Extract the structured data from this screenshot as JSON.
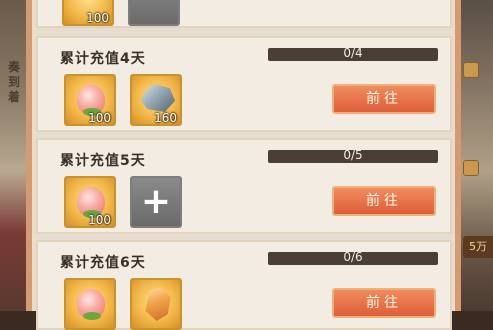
{
  "side_text": [
    "奏",
    "到",
    "着"
  ],
  "right_badge": "5万",
  "top_row": {
    "qty": "100"
  },
  "rows": [
    {
      "title": "累计充值4天",
      "progress_text": "0/4",
      "progress": 0,
      "items": [
        {
          "icon": "peach-icon",
          "qty": "100"
        },
        {
          "icon": "stone-icon",
          "qty": "160"
        }
      ],
      "button": "前往"
    },
    {
      "title": "累计充值5天",
      "progress_text": "0/5",
      "progress": 0,
      "items": [
        {
          "icon": "peach-icon",
          "qty": "100"
        },
        {
          "icon": "plus-icon",
          "qty": ""
        }
      ],
      "button": "前往"
    },
    {
      "title": "累计充值6天",
      "progress_text": "0/6",
      "progress": 0,
      "items": [
        {
          "icon": "peach-icon",
          "qty": ""
        },
        {
          "icon": "ore-icon",
          "qty": ""
        }
      ],
      "button": "前往"
    }
  ]
}
